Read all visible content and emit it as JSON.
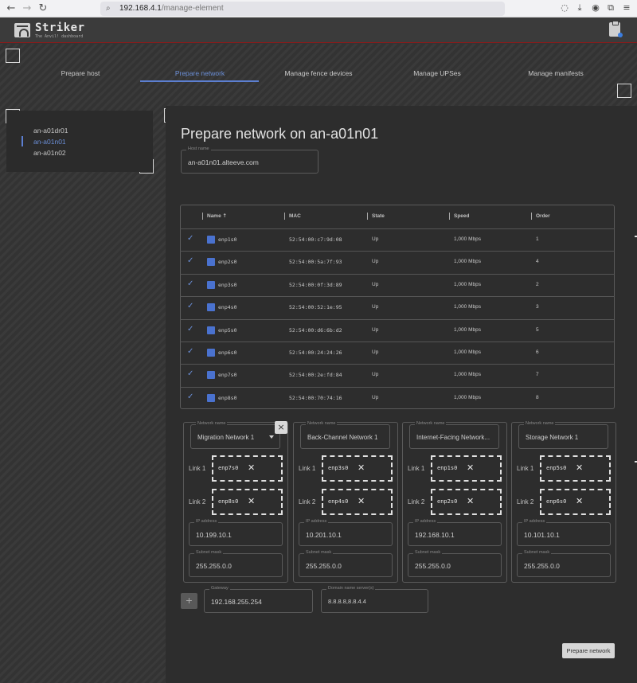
{
  "browser": {
    "url_host": "192.168.4.1",
    "url_path": "/manage-element",
    "back_icon": "arrow-left-icon",
    "forward_icon": "arrow-right-icon",
    "reload_icon": "reload-icon"
  },
  "header": {
    "brand": "Striker",
    "subtitle": "The Anvil! dashboard"
  },
  "tabs": [
    {
      "label": "Prepare host",
      "active": false
    },
    {
      "label": "Prepare network",
      "active": true
    },
    {
      "label": "Manage fence devices",
      "active": false
    },
    {
      "label": "Manage UPSes",
      "active": false
    },
    {
      "label": "Manage manifests",
      "active": false
    }
  ],
  "hosts": [
    {
      "label": "an-a01dr01",
      "active": false
    },
    {
      "label": "an-a01n01",
      "active": true
    },
    {
      "label": "an-a01n02",
      "active": false
    }
  ],
  "main": {
    "title": "Prepare network on an-a01n01",
    "host_name_label": "Host name",
    "host_name_value": "an-a01n01.alteeve.com"
  },
  "table": {
    "headers": {
      "name": "Name",
      "sort_icon": "arrow-up-icon",
      "mac": "MAC",
      "state": "State",
      "speed": "Speed",
      "order": "Order"
    },
    "rows": [
      {
        "name": "enp1s0",
        "mac": "52:54:00:c7:9d:08",
        "state": "Up",
        "speed": "1,000 Mbps",
        "order": "1"
      },
      {
        "name": "enp2s0",
        "mac": "52:54:00:5a:7f:93",
        "state": "Up",
        "speed": "1,000 Mbps",
        "order": "4"
      },
      {
        "name": "enp3s0",
        "mac": "52:54:00:0f:3d:89",
        "state": "Up",
        "speed": "1,000 Mbps",
        "order": "2"
      },
      {
        "name": "enp4s0",
        "mac": "52:54:00:52:1e:95",
        "state": "Up",
        "speed": "1,000 Mbps",
        "order": "3"
      },
      {
        "name": "enp5s0",
        "mac": "52:54:00:d6:6b:d2",
        "state": "Up",
        "speed": "1,000 Mbps",
        "order": "5"
      },
      {
        "name": "enp6s0",
        "mac": "52:54:00:24:24:26",
        "state": "Up",
        "speed": "1,000 Mbps",
        "order": "6"
      },
      {
        "name": "enp7s0",
        "mac": "52:54:00:2e:fd:84",
        "state": "Up",
        "speed": "1,000 Mbps",
        "order": "7"
      },
      {
        "name": "enp8s0",
        "mac": "52:54:00:70:74:16",
        "state": "Up",
        "speed": "1,000 Mbps",
        "order": "8"
      }
    ]
  },
  "networks": {
    "name_label": "Network name",
    "link1_label": "Link 1",
    "link2_label": "Link 2",
    "ip_label": "IP address",
    "mask_label": "Subnet mask",
    "cards": [
      {
        "name": "Migration Network 1",
        "link1": "enp7s0",
        "link2": "enp8s0",
        "ip": "10.199.10.1",
        "mask": "255.255.0.0"
      },
      {
        "name": "Back-Channel Network 1",
        "link1": "enp3s0",
        "link2": "enp4s0",
        "ip": "10.201.10.1",
        "mask": "255.255.0.0"
      },
      {
        "name": "Internet-Facing Network...",
        "link1": "enp1s0",
        "link2": "enp2s0",
        "ip": "192.168.10.1",
        "mask": "255.255.0.0"
      },
      {
        "name": "Storage Network 1",
        "link1": "enp5s0",
        "link2": "enp6s0",
        "ip": "10.101.10.1",
        "mask": "255.255.0.0"
      }
    ]
  },
  "gateway": {
    "label": "Gateway",
    "value": "192.168.255.254"
  },
  "dns": {
    "label": "Domain name server(s)",
    "value": "8.8.8.8,8.8.4.4"
  },
  "buttons": {
    "add": "+",
    "close": "×",
    "submit": "Prepare network"
  },
  "colors": {
    "accent": "#5c7fd1",
    "header_border": "#8b1a1a"
  }
}
